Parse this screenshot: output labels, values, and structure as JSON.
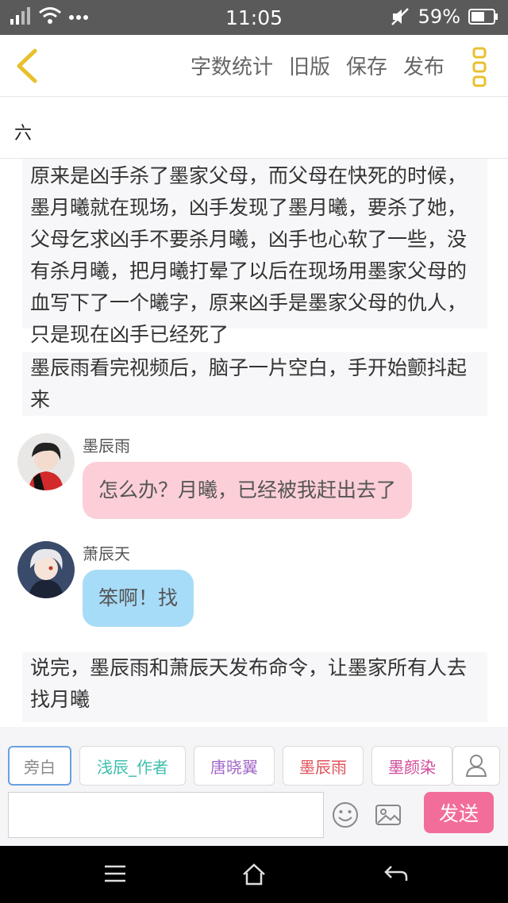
{
  "status": {
    "time": "11:05",
    "battery": "59%"
  },
  "toolbar": {
    "word_count": "字数统计",
    "old_version": "旧版",
    "save": "保存",
    "publish": "发布"
  },
  "chapter": {
    "title": "六"
  },
  "paragraphs": [
    "原来是凶手杀了墨家父母，而父母在快死的时候，墨月曦就在现场，凶手发现了墨月曦，要杀了她，父母乞求凶手不要杀月曦，凶手也心软了一些，没有杀月曦，把月曦打晕了以后在现场用墨家父母的血写下了一个曦字，原来凶手是墨家父母的仇人，只是现在凶手已经死了",
    "墨辰雨看完视频后，脑子一片空白，手开始颤抖起来",
    "说完，墨辰雨和萧辰天发布命令，让墨家所有人去找月曦"
  ],
  "messages": [
    {
      "name": "墨辰雨",
      "text": "怎么办？月曦，已经被我赶出去了"
    },
    {
      "name": "萧辰天",
      "text": "笨啊！找"
    }
  ],
  "roles": [
    {
      "label": "旁白",
      "color": "#8a8a8a"
    },
    {
      "label": "浅辰_作者",
      "color": "#3fbfae"
    },
    {
      "label": "唐晓翼",
      "color": "#a46ac9"
    },
    {
      "label": "墨辰雨",
      "color": "#e0525a"
    },
    {
      "label": "墨颜染",
      "color": "#d04a9a"
    }
  ],
  "composer": {
    "send_label": "发送",
    "placeholder": ""
  },
  "colors": {
    "accent_yellow": "#e8c02c",
    "send_pink": "#f26d99",
    "bubble_pink": "#fccfd8",
    "bubble_blue": "#a7dcf8"
  }
}
